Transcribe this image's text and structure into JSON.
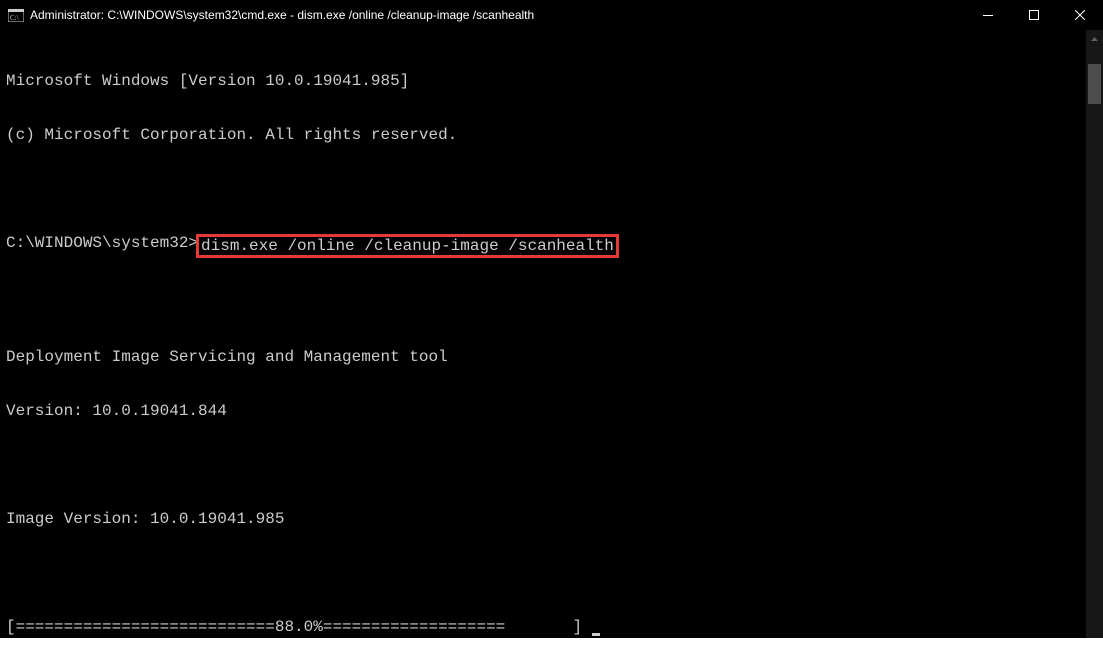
{
  "titlebar": {
    "title": "Administrator: C:\\WINDOWS\\system32\\cmd.exe - dism.exe  /online /cleanup-image /scanhealth"
  },
  "terminal": {
    "line1": "Microsoft Windows [Version 10.0.19041.985]",
    "line2": "(c) Microsoft Corporation. All rights reserved.",
    "prompt": "C:\\WINDOWS\\system32>",
    "command": "dism.exe /online /cleanup-image /scanhealth",
    "line_blank": "",
    "line5": "Deployment Image Servicing and Management tool",
    "line6": "Version: 10.0.19041.844",
    "line8": "Image Version: 10.0.19041.985",
    "progress": "[===========================88.0%===================       ] "
  },
  "progress_percent": 88.0
}
